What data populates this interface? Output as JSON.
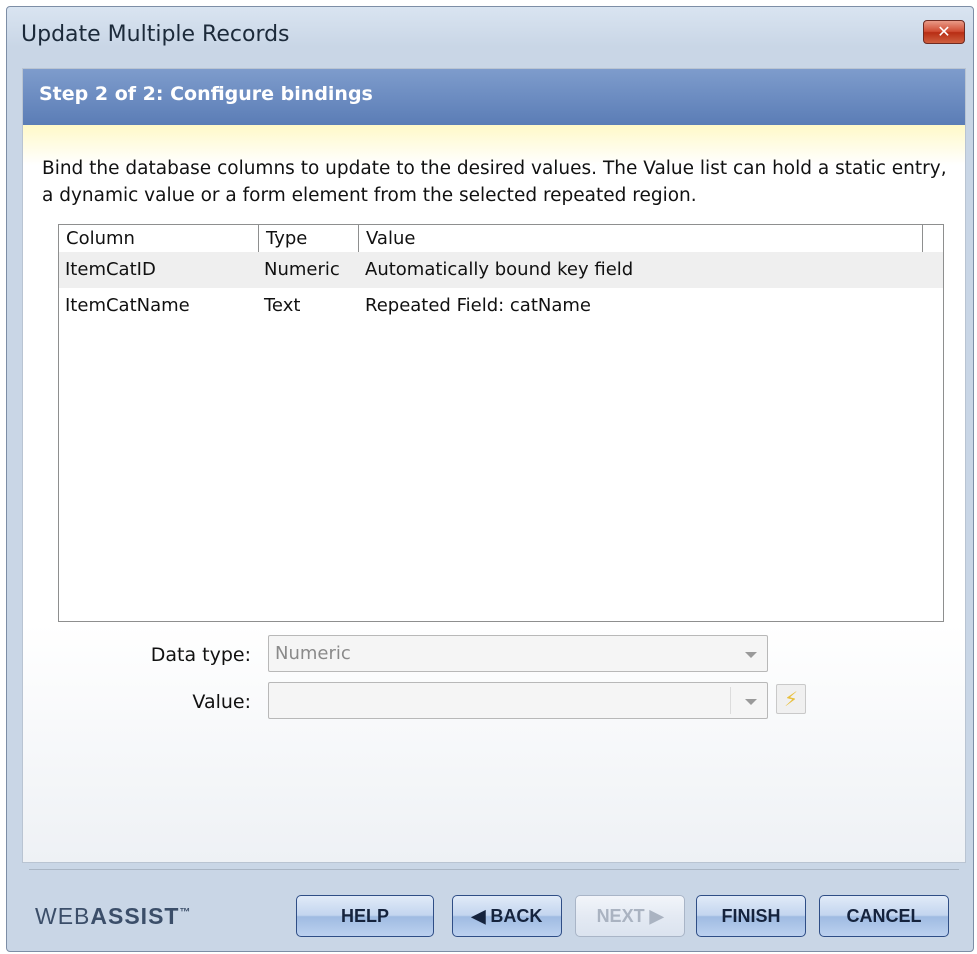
{
  "window": {
    "title": "Update Multiple Records",
    "close_glyph": "✕"
  },
  "step": {
    "title": "Step 2 of 2: Configure bindings"
  },
  "description": "Bind the database columns to update to the desired values. The Value list can hold a static entry, a dynamic value or a form element from the selected repeated region.",
  "bindings_table": {
    "columns": [
      "Column",
      "Type",
      "Value"
    ],
    "rows": [
      {
        "column": "ItemCatID",
        "type": "Numeric",
        "value": "Automatically bound key field"
      },
      {
        "column": "ItemCatName",
        "type": "Text",
        "value": "Repeated Field: catName"
      }
    ]
  },
  "form": {
    "data_type_label": "Data type:",
    "data_type_value": "Numeric",
    "value_label": "Value:",
    "value_value": ""
  },
  "footer": {
    "logo_text_1": "WEB",
    "logo_text_2": "ASSIST",
    "logo_tm": "™",
    "buttons": {
      "help": "HELP",
      "back": "◀ BACK",
      "next": "NEXT ▶",
      "finish": "FINISH",
      "cancel": "CANCEL"
    }
  },
  "icons": {
    "dynamic_value": "lightning-icon"
  }
}
